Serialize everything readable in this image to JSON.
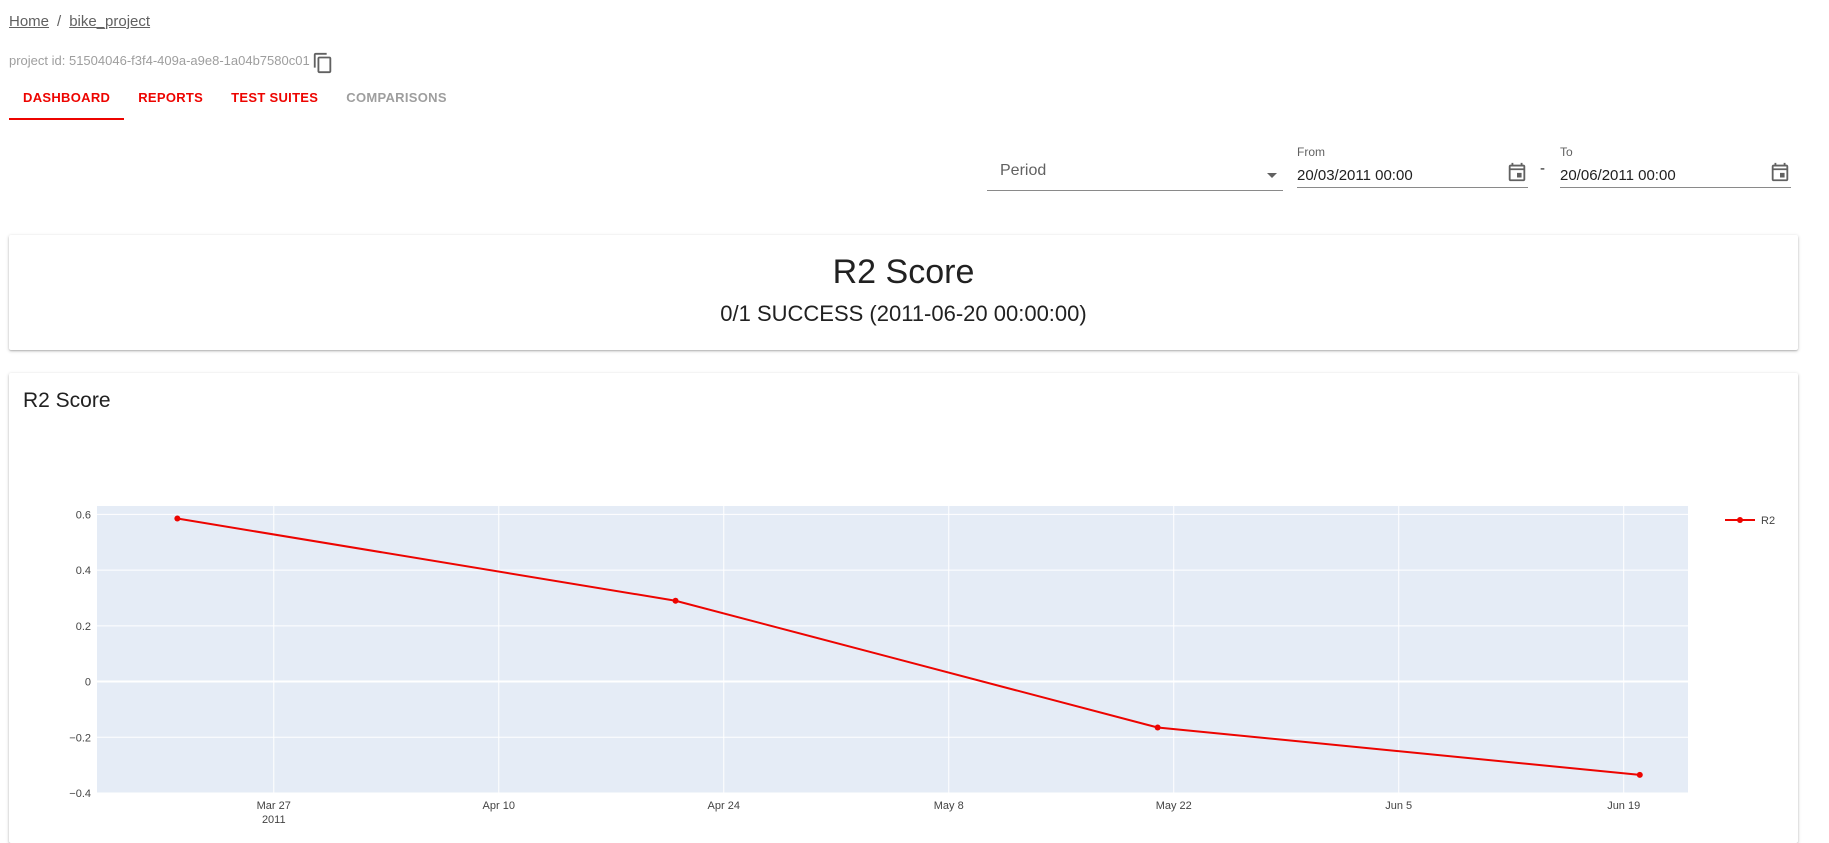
{
  "breadcrumb": {
    "home": "Home",
    "separator": "/",
    "project": "bike_project"
  },
  "project": {
    "id_label": "project id: 51504046-f3f4-409a-a9e8-1a04b7580c01",
    "copy_icon": "copy-icon"
  },
  "tabs": [
    {
      "label": "DASHBOARD",
      "active": true
    },
    {
      "label": "REPORTS",
      "active": false
    },
    {
      "label": "TEST SUITES",
      "active": false
    },
    {
      "label": "COMPARISONS",
      "active": false,
      "disabled": true
    }
  ],
  "filters": {
    "period_placeholder": "Period",
    "from_label": "From",
    "from_value": "20/03/2011 00:00",
    "range_separator": "-",
    "to_label": "To",
    "to_value": "20/06/2011 00:00",
    "calendar_icon": "calendar-icon"
  },
  "counter": {
    "title": "R2 Score",
    "value": "0/1 SUCCESS (2011-06-20 00:00:00)"
  },
  "plot": {
    "title": "R2 Score"
  },
  "colors": {
    "accent": "#ed0400",
    "plot_bg": "#e5ecf6",
    "grid": "#ffffff"
  },
  "chart_data": {
    "type": "line",
    "title": "R2 Score",
    "xlabel": "",
    "ylabel": "",
    "x_type": "date",
    "xlim": [
      "2011-03-16",
      "2011-06-23"
    ],
    "ylim": [
      -0.4,
      0.63
    ],
    "x_ticks": [
      "2011-03-27",
      "2011-04-10",
      "2011-04-24",
      "2011-05-08",
      "2011-05-22",
      "2011-06-05",
      "2011-06-19"
    ],
    "x_tick_labels": [
      "Mar 27",
      "Apr 10",
      "Apr 24",
      "May 8",
      "May 22",
      "Jun 5",
      "Jun 19"
    ],
    "x_tick_sublabel": "2011",
    "y_ticks": [
      -0.4,
      -0.2,
      0,
      0.2,
      0.4,
      0.6
    ],
    "y_tick_labels": [
      "−0.4",
      "−0.2",
      "0",
      "0.2",
      "0.4",
      "0.6"
    ],
    "grid": true,
    "legend": "top-right",
    "series": [
      {
        "name": "R2",
        "color": "#ed0400",
        "x": [
          "2011-03-21",
          "2011-04-21",
          "2011-05-21",
          "2011-06-20"
        ],
        "y": [
          0.585,
          0.29,
          -0.165,
          -0.335
        ]
      }
    ]
  }
}
